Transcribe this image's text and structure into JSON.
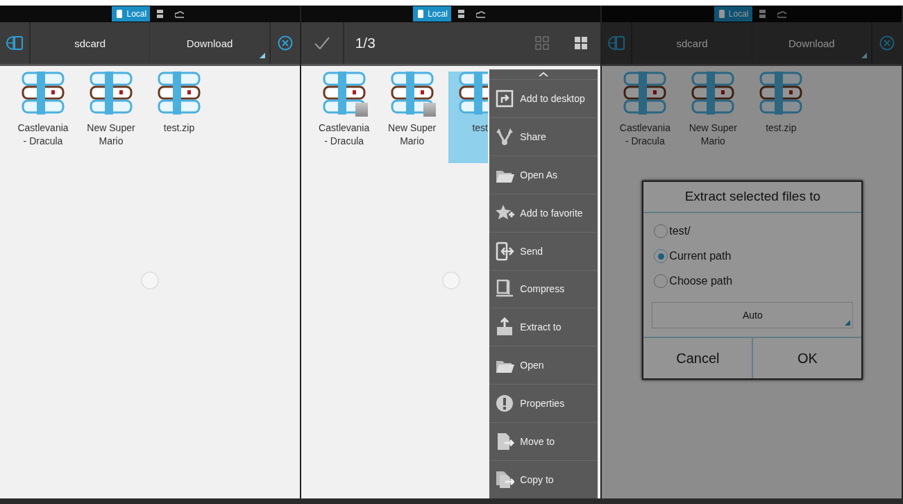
{
  "panels": [
    {
      "kind": "browse",
      "storage_tabs": [
        {
          "label": "Local",
          "selected": true
        },
        {
          "selected": false
        },
        {
          "selected": false
        }
      ],
      "path": [
        "sdcard",
        "Download"
      ],
      "files": [
        {
          "name": "Castlevania - Dracula",
          "selected": false
        },
        {
          "name": "New Super Mario",
          "selected": false
        },
        {
          "name": "test.zip",
          "selected": false
        }
      ]
    },
    {
      "kind": "select",
      "storage_tabs": [
        {
          "label": "Local",
          "selected": true
        },
        {
          "selected": false
        },
        {
          "selected": false
        }
      ],
      "count": "1/3",
      "files": [
        {
          "name": "Castlevania - Dracula",
          "selected": false
        },
        {
          "name": "New Super Mario",
          "selected": false
        },
        {
          "name": "test",
          "selected": true
        }
      ],
      "menu": [
        "Add to desktop",
        "Share",
        "Open As",
        "Add to favorite",
        "Send",
        "Compress",
        "Extract to",
        "Open",
        "Properties",
        "Move to",
        "Copy to"
      ]
    },
    {
      "kind": "dialog",
      "storage_tabs": [
        {
          "label": "Local",
          "selected": true
        },
        {
          "selected": false
        },
        {
          "selected": false
        }
      ],
      "path": [
        "sdcard",
        "Download"
      ],
      "files": [
        {
          "name": "Castlevania - Dracula",
          "selected": false
        },
        {
          "name": "New Super Mario",
          "selected": false
        },
        {
          "name": "test.zip",
          "selected": false
        }
      ],
      "dialog": {
        "title": "Extract selected files to",
        "options": [
          {
            "label": "test/",
            "selected": false
          },
          {
            "label": "Current path",
            "selected": true
          },
          {
            "label": "Choose path",
            "selected": false
          }
        ],
        "dropdown": "Auto",
        "buttons": [
          "Cancel",
          "OK"
        ]
      }
    }
  ]
}
